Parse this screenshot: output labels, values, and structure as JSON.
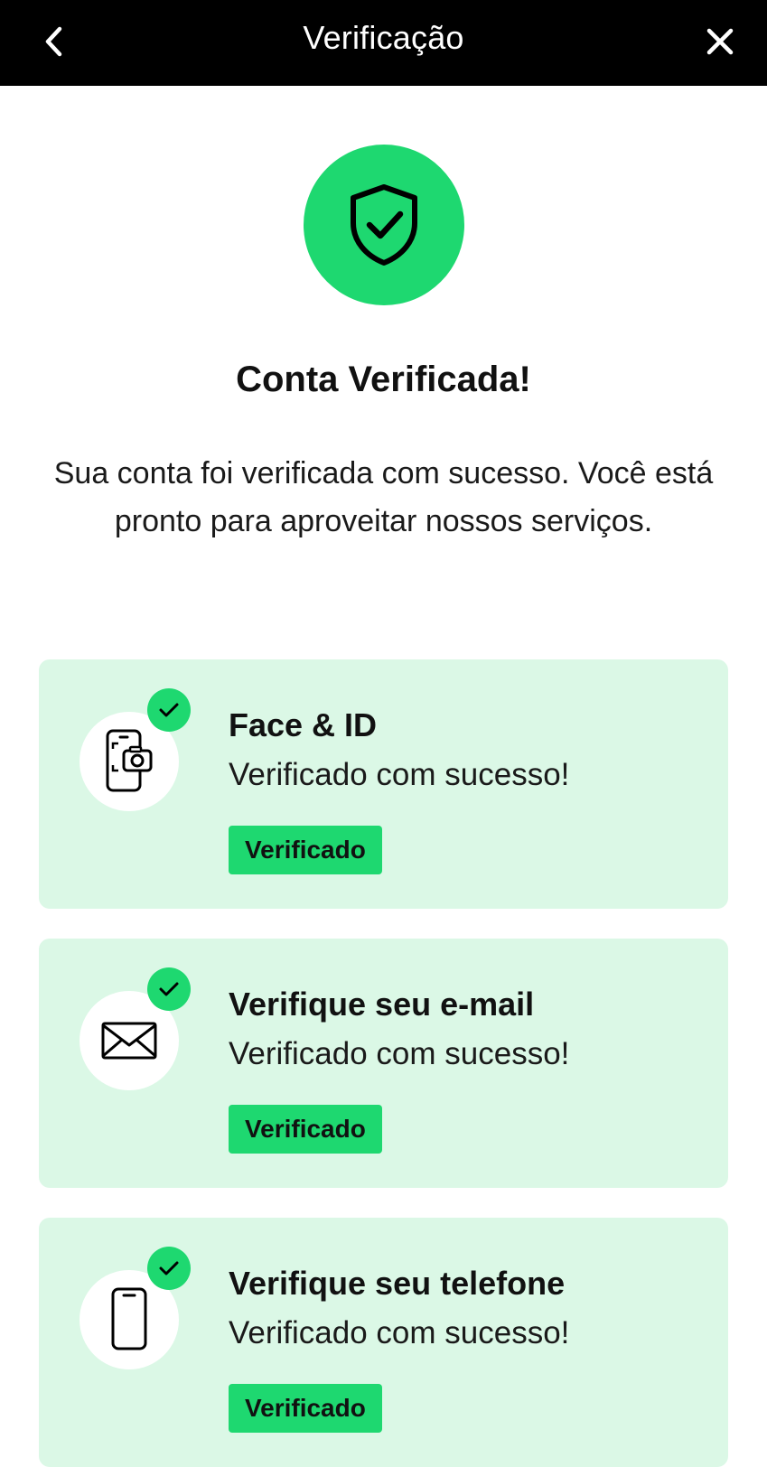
{
  "header": {
    "title": "Verificação",
    "back_icon": "chevron-left-icon",
    "close_icon": "close-icon"
  },
  "hero": {
    "icon": "shield-check-icon",
    "heading": "Conta Verificada!",
    "description": "Sua conta foi verificada com sucesso. Você está pronto para aproveitar nossos serviços."
  },
  "colors": {
    "accent": "#1ed870",
    "card_background": "#dbf8e6",
    "header_background": "#000000"
  },
  "items": [
    {
      "icon": "face-id-phone-icon",
      "title": "Face & ID",
      "subtitle": "Verificado com sucesso!",
      "badge": "Verificado"
    },
    {
      "icon": "envelope-icon",
      "title": "Verifique seu e-mail",
      "subtitle": "Verificado com sucesso!",
      "badge": "Verificado"
    },
    {
      "icon": "phone-icon",
      "title": "Verifique seu telefone",
      "subtitle": "Verificado com sucesso!",
      "badge": "Verificado"
    }
  ]
}
